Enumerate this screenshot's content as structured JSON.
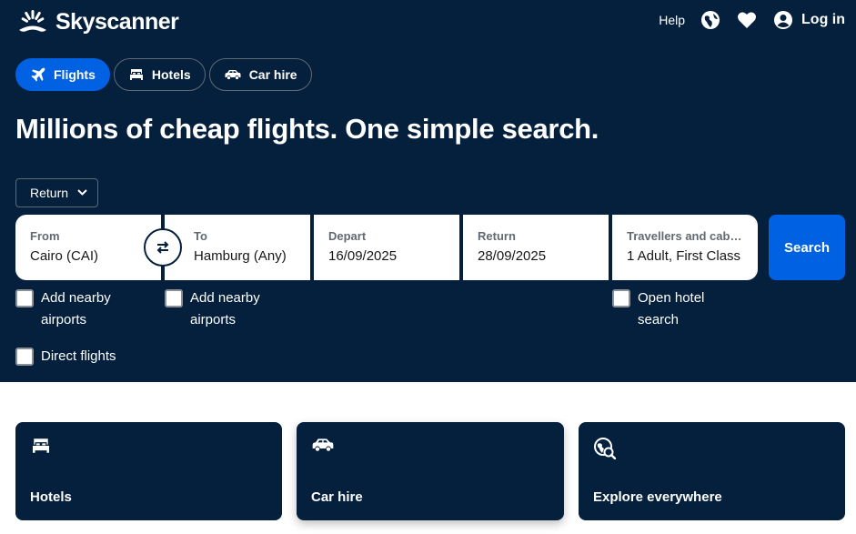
{
  "brand": {
    "name": "Skyscanner",
    "logo_icon": "sunrise-logo-icon"
  },
  "topnav": {
    "help_label": "Help",
    "region_icon": "globe-icon",
    "saved_icon": "heart-icon",
    "login_icon": "account-icon",
    "login_label": "Log in"
  },
  "tabs": [
    {
      "label": "Flights",
      "icon": "plane-icon",
      "active": true
    },
    {
      "label": "Hotels",
      "icon": "bed-icon",
      "active": false
    },
    {
      "label": "Car hire",
      "icon": "car-icon",
      "active": false
    }
  ],
  "headline": "Millions of cheap flights. One simple search.",
  "search": {
    "trip_type": "Return",
    "from": {
      "label": "From",
      "value": "Cairo (CAI)"
    },
    "to": {
      "label": "To",
      "value": "Hamburg (Any)"
    },
    "depart": {
      "label": "Depart",
      "value": "16/09/2025"
    },
    "return": {
      "label": "Return",
      "value": "28/09/2025"
    },
    "travellers": {
      "label": "Travellers and cabin class",
      "value": "1 Adult, First Class"
    },
    "swap_icon": "swap-arrows-icon",
    "search_label": "Search"
  },
  "options": {
    "nearby_from_label": "Add nearby airports",
    "nearby_to_label": "Add nearby airports",
    "hotel_label": "Open hotel search",
    "direct_label": "Direct flights"
  },
  "cards": [
    {
      "label": "Hotels",
      "icon": "bed-icon"
    },
    {
      "label": "Car hire",
      "icon": "car-icon"
    },
    {
      "label": "Explore everywhere",
      "icon": "globe-search-icon"
    }
  ],
  "colors": {
    "hero_bg": "#05203c",
    "accent": "#0062e3",
    "white": "#ffffff"
  }
}
